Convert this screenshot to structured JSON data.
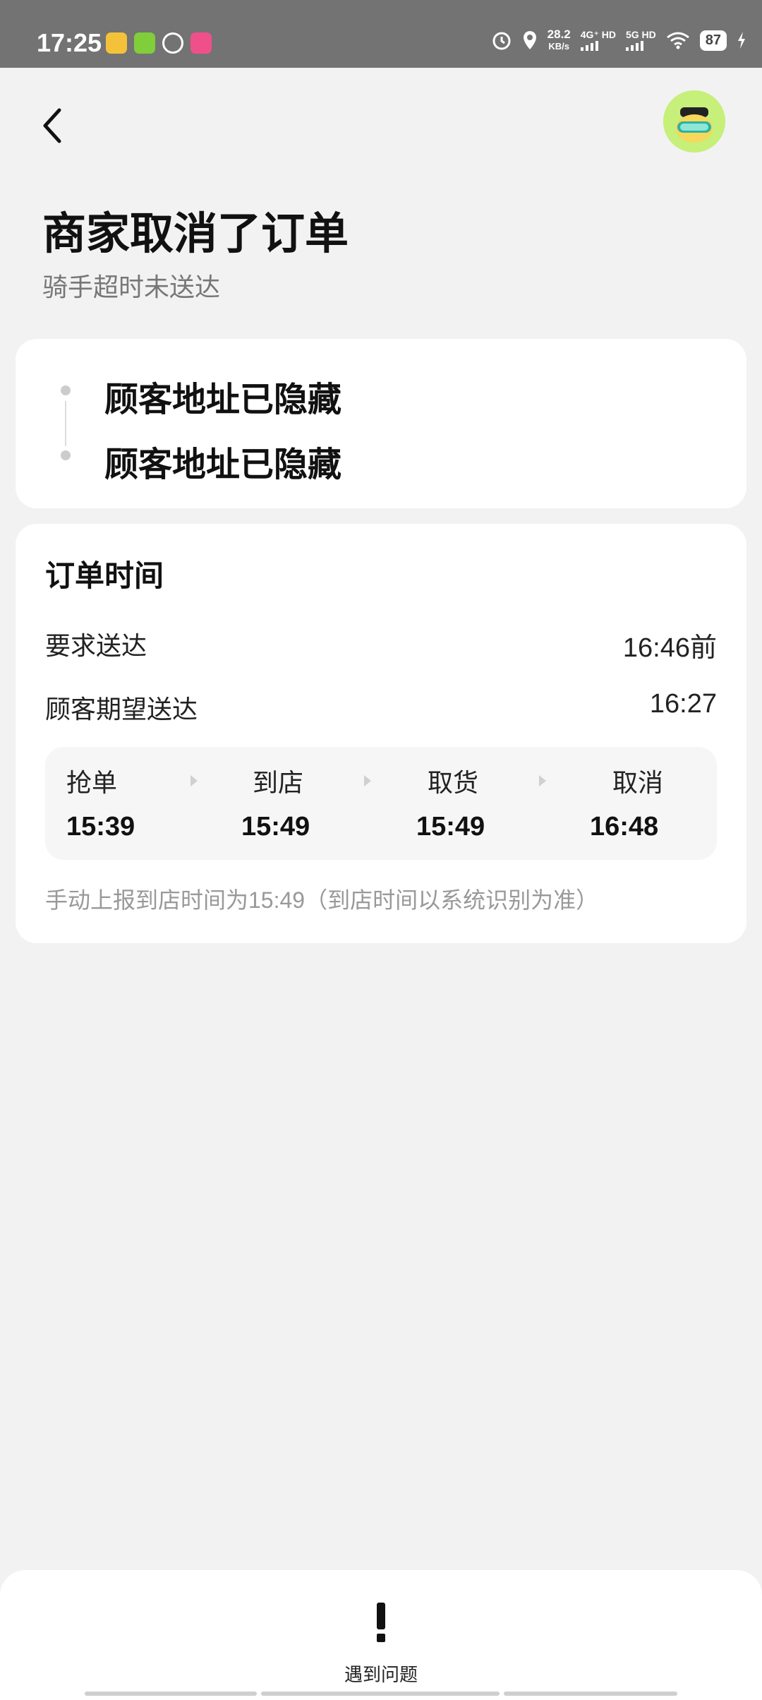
{
  "status_bar": {
    "time": "17:25",
    "speed_value": "28.2",
    "speed_unit": "KB/s",
    "sim1": "4G⁺ HD",
    "sim2": "5G HD",
    "battery": "87",
    "icons": [
      "app-icon-yellow",
      "app-icon-green",
      "app-icon-white",
      "app-icon-pink",
      "alarm-icon",
      "location-icon",
      "wifi-icon",
      "charging-icon"
    ]
  },
  "header": {
    "title": "商家取消了订单",
    "subtitle": "骑手超时未送达"
  },
  "address_card": {
    "pickup": "顾客地址已隐藏",
    "dropoff": "顾客地址已隐藏"
  },
  "order_time": {
    "title": "订单时间",
    "rows": [
      {
        "label": "要求送达",
        "value": "16:46前"
      },
      {
        "label": "顾客期望送达",
        "value": "16:27"
      }
    ],
    "steps": [
      {
        "label": "抢单",
        "time": "15:39"
      },
      {
        "label": "到店",
        "time": "15:49"
      },
      {
        "label": "取货",
        "time": "15:49"
      },
      {
        "label": "取消",
        "time": "16:48"
      }
    ],
    "note": "手动上报到店时间为15:49（到店时间以系统识别为准）"
  },
  "bottom": {
    "problem_label": "遇到问题"
  },
  "colors": {
    "status_bar": "#737373",
    "background": "#f2f2f2",
    "card": "#ffffff",
    "avatar_bg": "#c6f07a"
  }
}
